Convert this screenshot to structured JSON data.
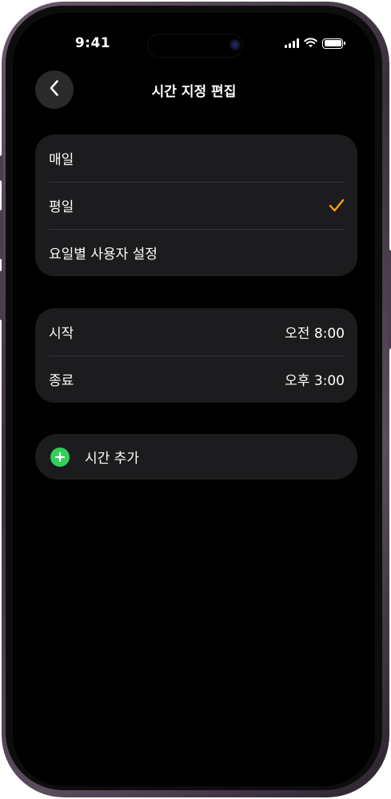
{
  "status_bar": {
    "time": "9:41"
  },
  "nav": {
    "title": "시간 지정 편집"
  },
  "schedule_options": [
    {
      "label": "매일",
      "selected": false
    },
    {
      "label": "평일",
      "selected": true
    },
    {
      "label": "요일별 사용자 설정",
      "selected": false
    }
  ],
  "time_range": {
    "start_label": "시작",
    "start_value": "오전 8:00",
    "end_label": "종료",
    "end_value": "오후 3:00"
  },
  "add_time": {
    "label": "시간 추가"
  },
  "colors": {
    "accent": "#FF9F0A",
    "add_green": "#30D158",
    "group_bg": "#1C1C1E"
  }
}
